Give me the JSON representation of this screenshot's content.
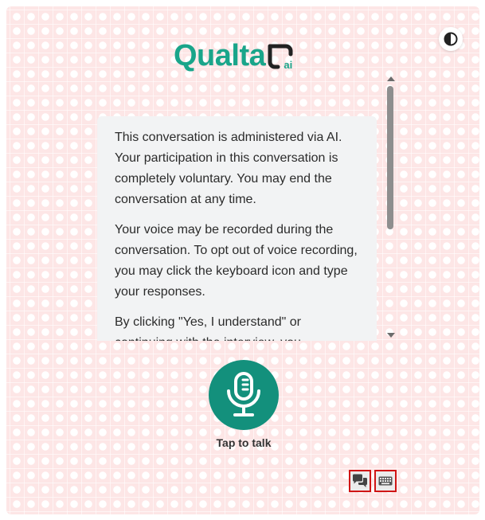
{
  "header": {
    "logo_text": "Qualta",
    "logo_suffix": "ai"
  },
  "theme_toggle": {
    "icon": "contrast-icon"
  },
  "consent_message": {
    "paragraphs": [
      "This conversation is administered via AI. Your participation in this conversation is completely voluntary. You may end the conversation at any time.",
      "Your voice may be recorded during the conversation. To opt out of voice recording, you may click the keyboard icon and type your responses.",
      "By clicking \"Yes, I understand\" or continuing with the interview, you"
    ]
  },
  "voice": {
    "icon": "microphone-icon",
    "label": "Tap to talk"
  },
  "mode_switch": {
    "chat_icon": "chat-bubbles-icon",
    "keyboard_icon": "keyboard-icon"
  },
  "colors": {
    "brand": "#1aa58a",
    "mic_button": "#13907c",
    "background_pattern": "#fde6e6",
    "highlight_border": "#d01515"
  }
}
